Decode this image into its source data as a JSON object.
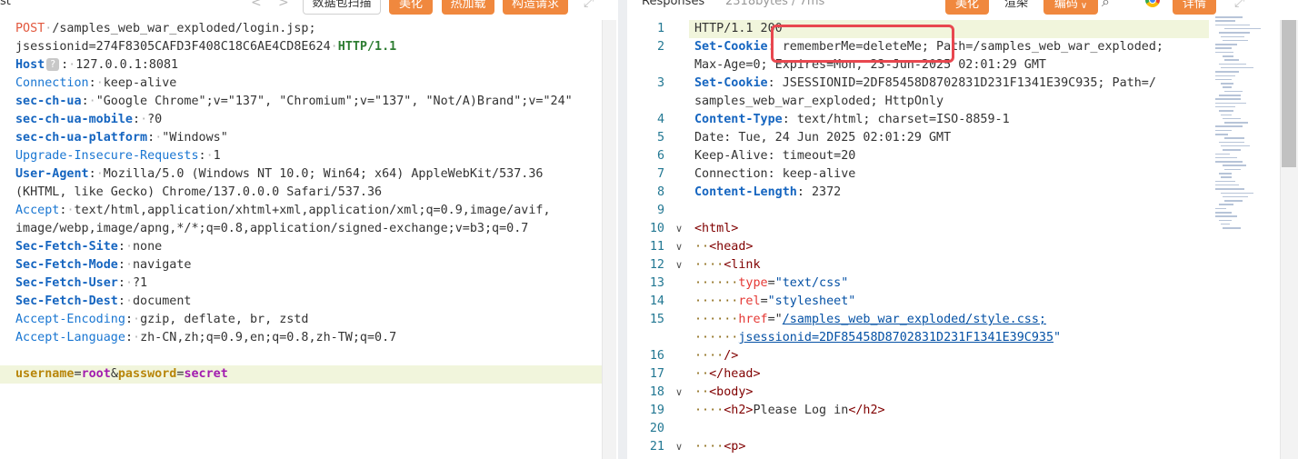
{
  "left_toolbar": {
    "title_fragment": "st",
    "back_glyph": "<",
    "forward_glyph": ">",
    "packet_scan_label": "数据包扫描",
    "beautify_label": "美化",
    "hot_load_label": "热加载",
    "construct_request_label": "构造请求",
    "expand_icon_glyph": "⤢"
  },
  "request": {
    "method": "POST",
    "path": "/samples_web_war_exploded/login.jsp;",
    "jsessionid_line": "jsessionid=274F8305CAFD3F408C18C6AE4CD8E624",
    "protocol": "HTTP/1.1",
    "host_name": "Host",
    "host_badge": "?",
    "host_value": "127.0.0.1:8081",
    "headers": [
      {
        "name": "Connection",
        "value": "keep-alive",
        "bold": false
      },
      {
        "name": "sec-ch-ua",
        "value": "\"Google Chrome\";v=\"137\", \"Chromium\";v=\"137\", \"Not/A)Brand\";v=\"24\"",
        "bold": true
      },
      {
        "name": "sec-ch-ua-mobile",
        "value": "?0",
        "bold": true
      },
      {
        "name": "sec-ch-ua-platform",
        "value": "\"Windows\"",
        "bold": true
      },
      {
        "name": "Upgrade-Insecure-Requests",
        "value": "1",
        "bold": false
      },
      {
        "name": "User-Agent",
        "value": "Mozilla/5.0 (Windows NT 10.0; Win64; x64) AppleWebKit/537.36",
        "bold": true
      },
      {
        "name": "",
        "value": "(KHTML, like Gecko) Chrome/137.0.0.0 Safari/537.36",
        "bold": false
      },
      {
        "name": "Accept",
        "value": "text/html,application/xhtml+xml,application/xml;q=0.9,image/avif,",
        "bold": false
      },
      {
        "name": "",
        "value": "image/webp,image/apng,*/*;q=0.8,application/signed-exchange;v=b3;q=0.7",
        "bold": false
      },
      {
        "name": "Sec-Fetch-Site",
        "value": "none",
        "bold": true
      },
      {
        "name": "Sec-Fetch-Mode",
        "value": "navigate",
        "bold": true
      },
      {
        "name": "Sec-Fetch-User",
        "value": "?1",
        "bold": true
      },
      {
        "name": "Sec-Fetch-Dest",
        "value": "document",
        "bold": true
      },
      {
        "name": "Accept-Encoding",
        "value": "gzip, deflate, br, zstd",
        "bold": false
      },
      {
        "name": "Accept-Language",
        "value": "zh-CN,zh;q=0.9,en;q=0.8,zh-TW;q=0.7",
        "bold": false
      }
    ],
    "body": {
      "param1_name": "username",
      "param1_value": "root",
      "param2_name": "password",
      "param2_value": "secret"
    }
  },
  "right_toolbar": {
    "title": "Responses",
    "size_info": "2318bytes / 7ms",
    "beautify_label": "美化",
    "render_label": "渲染",
    "encoding_label": "编码",
    "search_icon_glyph": "⌕",
    "details_label": "详情",
    "expand_icon_glyph": "⤢"
  },
  "response": {
    "lines": [
      {
        "n": "1",
        "fold": "",
        "segments": [
          {
            "t": "HTTP/1.1 200",
            "c": ""
          }
        ]
      },
      {
        "n": "2",
        "fold": "",
        "segments": [
          {
            "t": "Set-Cookie",
            "c": "r-key"
          },
          {
            "t": ": rememberMe=deleteMe; Path=/samples_web_war_exploded;",
            "c": ""
          }
        ]
      },
      {
        "n": "",
        "fold": "",
        "segments": [
          {
            "t": "Max-Age=0; Expires=Mon, 23-Jun-2025 02:01:29 GMT",
            "c": ""
          }
        ]
      },
      {
        "n": "3",
        "fold": "",
        "segments": [
          {
            "t": "Set-Cookie",
            "c": "r-key"
          },
          {
            "t": ": JSESSIONID=2DF85458D8702831D231F1341E39C935; Path=/",
            "c": ""
          }
        ]
      },
      {
        "n": "",
        "fold": "",
        "segments": [
          {
            "t": "samples_web_war_exploded; HttpOnly",
            "c": ""
          }
        ]
      },
      {
        "n": "4",
        "fold": "",
        "segments": [
          {
            "t": "Content-Type",
            "c": "r-key"
          },
          {
            "t": ": text/html; charset=ISO-8859-1",
            "c": ""
          }
        ]
      },
      {
        "n": "5",
        "fold": "",
        "segments": [
          {
            "t": "Date: Tue, 24 Jun 2025 02:01:29 GMT",
            "c": ""
          }
        ]
      },
      {
        "n": "6",
        "fold": "",
        "segments": [
          {
            "t": "Keep-Alive: timeout=20",
            "c": ""
          }
        ]
      },
      {
        "n": "7",
        "fold": "",
        "segments": [
          {
            "t": "Connection: keep-alive",
            "c": ""
          }
        ]
      },
      {
        "n": "8",
        "fold": "",
        "segments": [
          {
            "t": "Content-Length",
            "c": "r-key"
          },
          {
            "t": ": 2372",
            "c": ""
          }
        ]
      },
      {
        "n": "9",
        "fold": "",
        "segments": []
      },
      {
        "n": "10",
        "fold": "∨",
        "segments": [
          {
            "t": "<html>",
            "c": "r-tag"
          }
        ]
      },
      {
        "n": "11",
        "fold": "∨",
        "segments": [
          {
            "t": "··",
            "c": "guide"
          },
          {
            "t": "<head>",
            "c": "r-tag"
          }
        ]
      },
      {
        "n": "12",
        "fold": "∨",
        "segments": [
          {
            "t": "····",
            "c": "guide"
          },
          {
            "t": "<link",
            "c": "r-tag"
          }
        ]
      },
      {
        "n": "13",
        "fold": "",
        "segments": [
          {
            "t": "······",
            "c": "guide"
          },
          {
            "t": "type",
            "c": "r-attr"
          },
          {
            "t": "=",
            "c": ""
          },
          {
            "t": "\"text/css\"",
            "c": "r-str"
          }
        ]
      },
      {
        "n": "14",
        "fold": "",
        "segments": [
          {
            "t": "······",
            "c": "guide"
          },
          {
            "t": "rel",
            "c": "r-attr"
          },
          {
            "t": "=",
            "c": ""
          },
          {
            "t": "\"stylesheet\"",
            "c": "r-str"
          }
        ]
      },
      {
        "n": "15",
        "fold": "",
        "segments": [
          {
            "t": "······",
            "c": "guide"
          },
          {
            "t": "href",
            "c": "r-attr"
          },
          {
            "t": "=\"",
            "c": ""
          },
          {
            "t": "/samples_web_war_exploded/style.css;",
            "c": "r-link"
          }
        ]
      },
      {
        "n": "",
        "fold": "",
        "segments": [
          {
            "t": "······",
            "c": "guide"
          },
          {
            "t": "jsessionid=2DF85458D8702831D231F1341E39C935",
            "c": "r-link"
          },
          {
            "t": "\"",
            "c": "r-str"
          }
        ]
      },
      {
        "n": "16",
        "fold": "",
        "segments": [
          {
            "t": "····",
            "c": "guide"
          },
          {
            "t": "/>",
            "c": "r-tag"
          }
        ]
      },
      {
        "n": "17",
        "fold": "",
        "segments": [
          {
            "t": "··",
            "c": "guide"
          },
          {
            "t": "</head>",
            "c": "r-tag"
          }
        ]
      },
      {
        "n": "18",
        "fold": "∨",
        "segments": [
          {
            "t": "··",
            "c": "guide"
          },
          {
            "t": "<body>",
            "c": "r-tag"
          }
        ]
      },
      {
        "n": "19",
        "fold": "",
        "segments": [
          {
            "t": "····",
            "c": "guide"
          },
          {
            "t": "<h2>",
            "c": "r-tag"
          },
          {
            "t": "Please Log in",
            "c": ""
          },
          {
            "t": "</h2>",
            "c": "r-tag"
          }
        ]
      },
      {
        "n": "20",
        "fold": "",
        "segments": []
      },
      {
        "n": "21",
        "fold": "∨",
        "segments": [
          {
            "t": "····",
            "c": "guide"
          },
          {
            "t": "<p>",
            "c": "r-tag"
          }
        ]
      }
    ]
  },
  "colors": {
    "accent_orange": "#f0883e",
    "highlight_box": "#e8474f",
    "header_key_blue": "#1565c0",
    "html_tag": "#800000",
    "attr_name": "#e53935",
    "string_value": "#0451a5",
    "line_highlight": "#f1f5dc"
  }
}
